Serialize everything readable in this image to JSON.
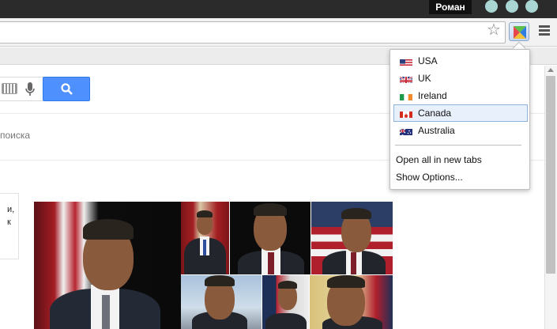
{
  "window": {
    "profile_name": "Роман"
  },
  "toolbar": {
    "bookmark_icon": "star-icon",
    "extension_icon": "flag-switcher-extension-icon",
    "menu_icon": "hamburger-menu-icon"
  },
  "page": {
    "search_tools_text": "поиска",
    "card_lines": [
      "и,",
      "к"
    ]
  },
  "popup": {
    "countries": [
      {
        "label": "USA",
        "flag": "us-flag-icon",
        "selected": false
      },
      {
        "label": "UK",
        "flag": "uk-flag-icon",
        "selected": false
      },
      {
        "label": "Ireland",
        "flag": "ireland-flag-icon",
        "selected": false
      },
      {
        "label": "Canada",
        "flag": "canada-flag-icon",
        "selected": true
      },
      {
        "label": "Australia",
        "flag": "australia-flag-icon",
        "selected": false
      }
    ],
    "open_all_label": "Open all in new tabs",
    "show_options_label": "Show Options..."
  },
  "colors": {
    "search_button": "#4d90fe",
    "selection_bg": "#e8f1fb",
    "selection_border": "#8fb2dc",
    "window_button": "#a9d6d2"
  }
}
